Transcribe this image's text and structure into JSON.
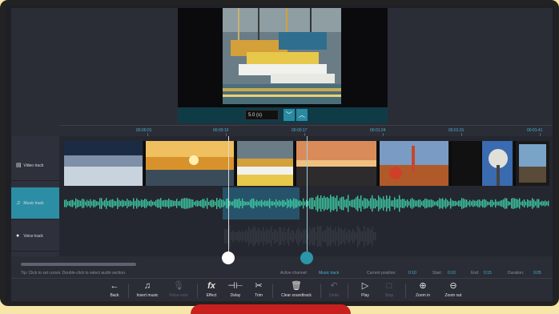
{
  "preview": {
    "duration_value": "5.0 (s)",
    "down_icon": "﹀",
    "up_icon": "︿"
  },
  "ruler": {
    "ticks": [
      "00:00:01",
      "00:00:10",
      "00:00:17",
      "00:01:24",
      "00:01:31",
      "00:01:41"
    ]
  },
  "tracks": {
    "video_label": "Video track",
    "music_label": "Music track",
    "voice_label": "Voice track"
  },
  "status": {
    "tip": "Tip: Click to set cursor. Double-click to select audio section.",
    "active_channel_label": "Active channel:",
    "active_channel_value": "Music track",
    "current_position_label": "Current position:",
    "current_position_value": "0:10",
    "start_label": "Start:",
    "start_value": "0:10",
    "end_label": "End:",
    "end_value": "0:15",
    "duration_label": "Duration:",
    "duration_value": "0:05"
  },
  "toolbar": {
    "back": "Back",
    "insert_music": "Insert music",
    "voice_over": "Voice-over",
    "effect": "Effect",
    "delay": "Delay",
    "trim": "Trim",
    "clear_soundtrack": "Clear soundtrack",
    "undo": "Undo",
    "play": "Play",
    "stop": "Stop",
    "zoom_in": "Zoom in",
    "zoom_out": "Zoom out"
  },
  "colors": {
    "accent": "#2a96a8",
    "wave": "#3cc8a0",
    "ruler_text": "#4bb2d0"
  }
}
